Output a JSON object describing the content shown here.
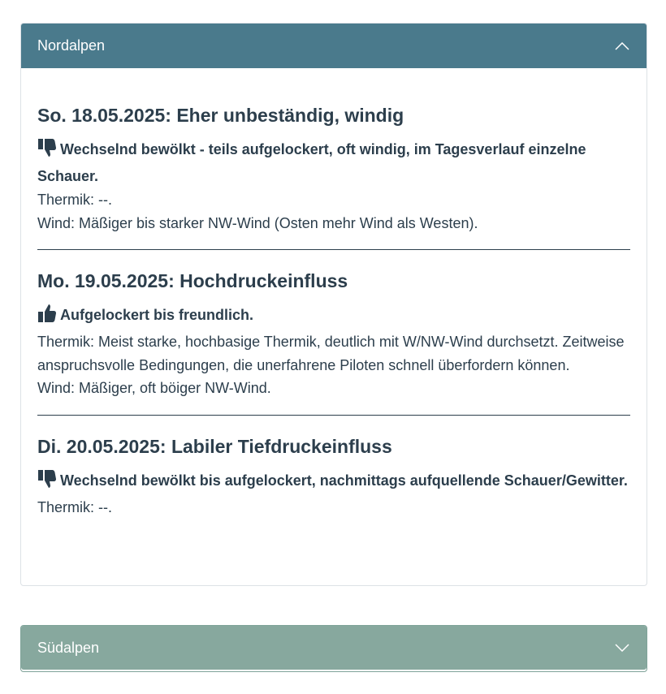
{
  "sections": {
    "nord": {
      "title": "Nordalpen",
      "expanded": true,
      "days": [
        {
          "heading": "So. 18.05.2025: Eher unbeständig, windig",
          "rating_icon": "thumbs-down-icon",
          "summary": "Wechselnd bewölkt - teils aufgelockert, oft windig, im Tagesverlauf einzelne Schauer.",
          "thermik": "Thermik: --.",
          "wind": "Wind: Mäßiger bis starker NW-Wind (Osten mehr Wind als Westen)."
        },
        {
          "heading": "Mo. 19.05.2025: Hochdruckeinfluss",
          "rating_icon": "thumbs-up-icon",
          "summary": "Aufgelockert bis freundlich.",
          "thermik": "Thermik: Meist starke, hochbasige Thermik, deutlich mit W/NW-Wind durchsetzt. Zeit­weise anspruchsvolle Bedingungen, die unerfahrene Piloten schnell überfordern kön­nen.",
          "wind": "Wind: Mäßiger, oft böiger NW-Wind."
        },
        {
          "heading": "Di. 20.05.2025: Labiler Tiefdruckeinfluss",
          "rating_icon": "thumbs-down-icon",
          "summary": "Wechselnd bewölkt bis aufgelockert, nachmittags aufquellende Schauer/Gewitter.",
          "thermik": "Thermik: --."
        }
      ]
    },
    "sued": {
      "title": "Südalpen",
      "expanded": false
    }
  },
  "colors": {
    "nord_header": "#4a7a8c",
    "sued_header": "#87a89e",
    "text": "#2c3e4c"
  }
}
